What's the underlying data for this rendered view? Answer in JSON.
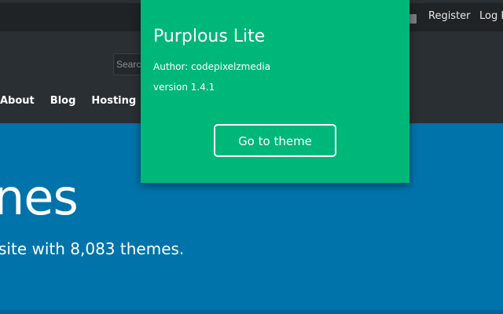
{
  "topbar": {
    "register": "Register",
    "login": "Log In"
  },
  "header": {
    "search_placeholder": "Search"
  },
  "nav": {
    "items": [
      {
        "label": "About"
      },
      {
        "label": "Blog"
      },
      {
        "label": "Hosting"
      }
    ]
  },
  "hero": {
    "title": "nes",
    "subtitle": "site with 8,083 themes."
  },
  "popup": {
    "title": "Purplous Lite",
    "author": "Author: codepixelzmedia",
    "version": "version 1.4.1",
    "button": "Go to theme"
  }
}
